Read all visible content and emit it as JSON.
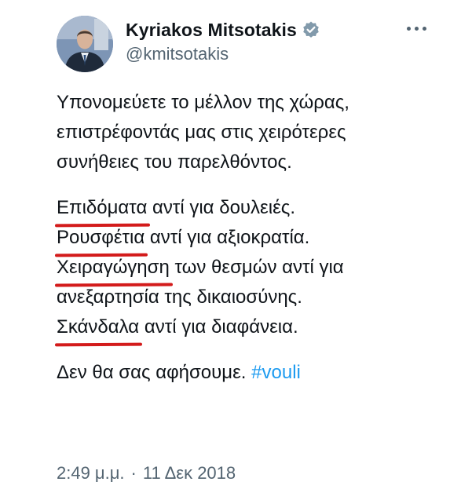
{
  "author": {
    "name": "Kyriakos Mitsotakis",
    "handle": "@kmitsotakis",
    "verified": true
  },
  "icons": {
    "verified": "verified-badge-icon",
    "more": "more-options-icon"
  },
  "colors": {
    "text": "#0f1419",
    "secondary": "#536471",
    "link": "#1d9bf0",
    "underline": "#d31b1b"
  },
  "tweet": {
    "intro_lines": [
      "Υπονομεύετε το μέλλον της χώρας,",
      "επιστρέφοντάς μας στις χειρότερες",
      "συνήθειες του παρελθόντος."
    ],
    "contrasts": [
      {
        "highlight": "Επιδόματα",
        "rest": " αντί για δουλειές."
      },
      {
        "highlight": "Ρουσφέτια",
        "rest": " αντί για αξιοκρατία."
      },
      {
        "highlight": "Χειραγώγηση",
        "rest": " των θεσμών αντί για"
      },
      {
        "highlight": "",
        "rest": "ανεξαρτησία της δικαιοσύνης."
      },
      {
        "highlight": "Σκάνδαλα",
        "rest": " αντί για διαφάνεια."
      }
    ],
    "closing": "Δεν θα σας αφήσουμε.",
    "hashtag": "#vouli"
  },
  "meta": {
    "time": "2:49 μ.μ.",
    "separator": "·",
    "date": "11 Δεκ 2018"
  }
}
